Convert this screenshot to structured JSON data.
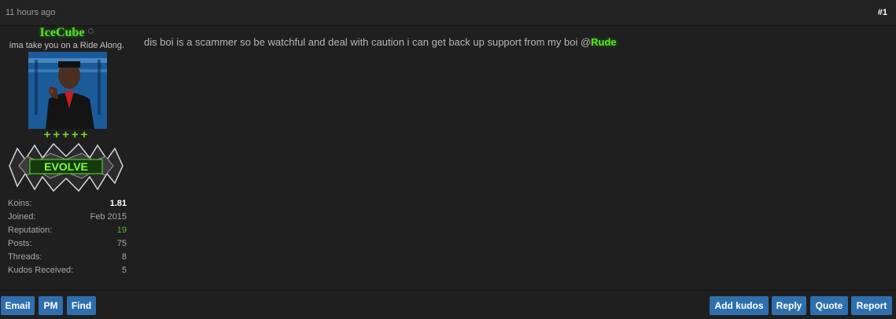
{
  "post": {
    "time": "11 hours ago",
    "number": "#1"
  },
  "user": {
    "name": "IceCube",
    "title": "ima take you on a Ride Along.",
    "stars": "+++++",
    "rank_badge_text": "EVOLVE",
    "status_icon": "offline-dot"
  },
  "stats": [
    {
      "label": "Koins:",
      "value": "1.81"
    },
    {
      "label": "Joined:",
      "value": "Feb 2015"
    },
    {
      "label": "Reputation:",
      "value": "19"
    },
    {
      "label": "Posts:",
      "value": "75"
    },
    {
      "label": "Threads:",
      "value": "8"
    },
    {
      "label": "Kudos Received:",
      "value": "5"
    }
  ],
  "message": {
    "text": "dis boi is a scammer so be watchful and deal with caution i can get back up support from my boi @",
    "mention": "Rude"
  },
  "actions": {
    "email": "Email",
    "pm": "PM",
    "find": "Find",
    "add_kudos": "Add kudos",
    "reply": "Reply",
    "quote": "Quote",
    "report": "Report"
  },
  "colors": {
    "accent_green": "#56e02a",
    "button_blue": "#2f6fad",
    "background": "#1f1f20"
  }
}
